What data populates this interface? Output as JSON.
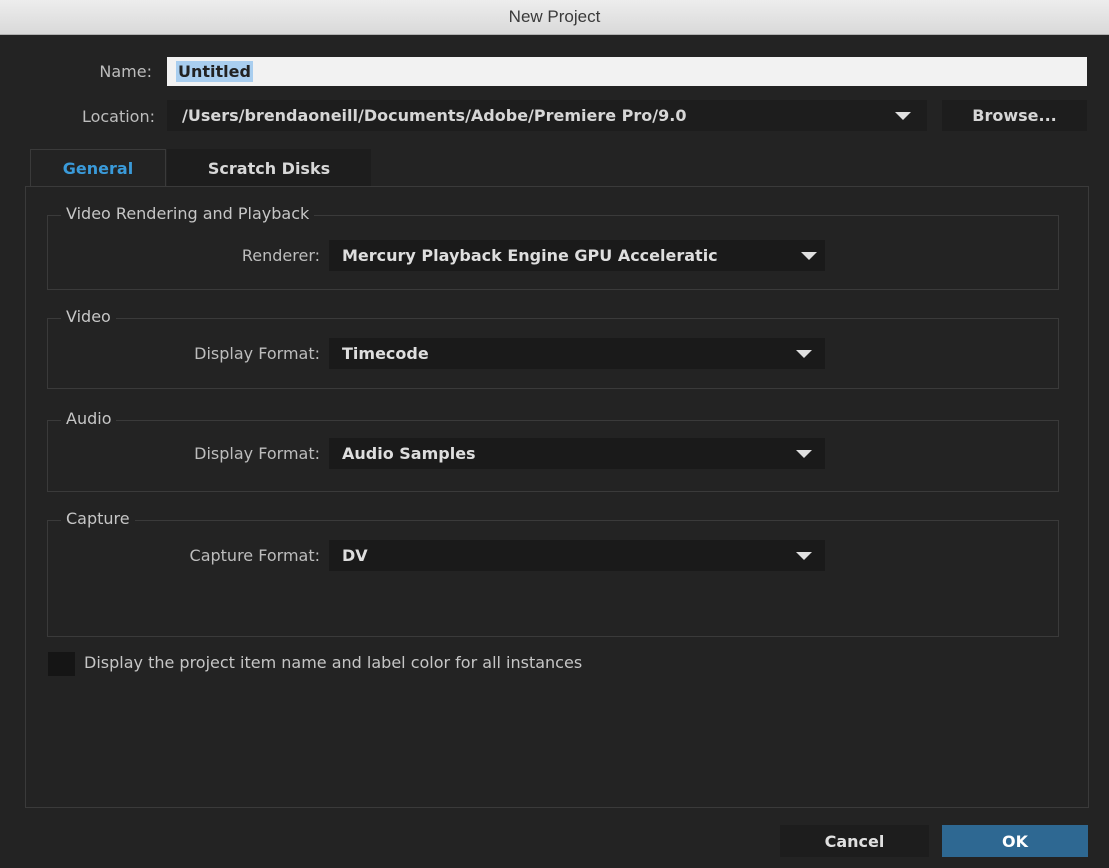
{
  "window": {
    "title": "New Project"
  },
  "name": {
    "label": "Name:",
    "value": "Untitled"
  },
  "location": {
    "label": "Location:",
    "value": "/Users/brendaoneill/Documents/Adobe/Premiere Pro/9.0",
    "browse_label": "Browse..."
  },
  "tabs": [
    {
      "label": "General",
      "active": true
    },
    {
      "label": "Scratch Disks",
      "active": false
    }
  ],
  "groups": {
    "video_rendering": {
      "title": "Video Rendering and Playback",
      "field_label": "Renderer:",
      "value": "Mercury Playback Engine GPU Acceleratic"
    },
    "video": {
      "title": "Video",
      "field_label": "Display Format:",
      "value": "Timecode"
    },
    "audio": {
      "title": "Audio",
      "field_label": "Display Format:",
      "value": "Audio Samples"
    },
    "capture": {
      "title": "Capture",
      "field_label": "Capture Format:",
      "value": "DV"
    }
  },
  "checkbox": {
    "label": "Display the project item name and label color for all instances",
    "checked": false
  },
  "buttons": {
    "cancel": "Cancel",
    "ok": "OK"
  },
  "colors": {
    "accent_tab": "#3a9ad9",
    "ok_button": "#2e6892",
    "background": "#232323"
  }
}
